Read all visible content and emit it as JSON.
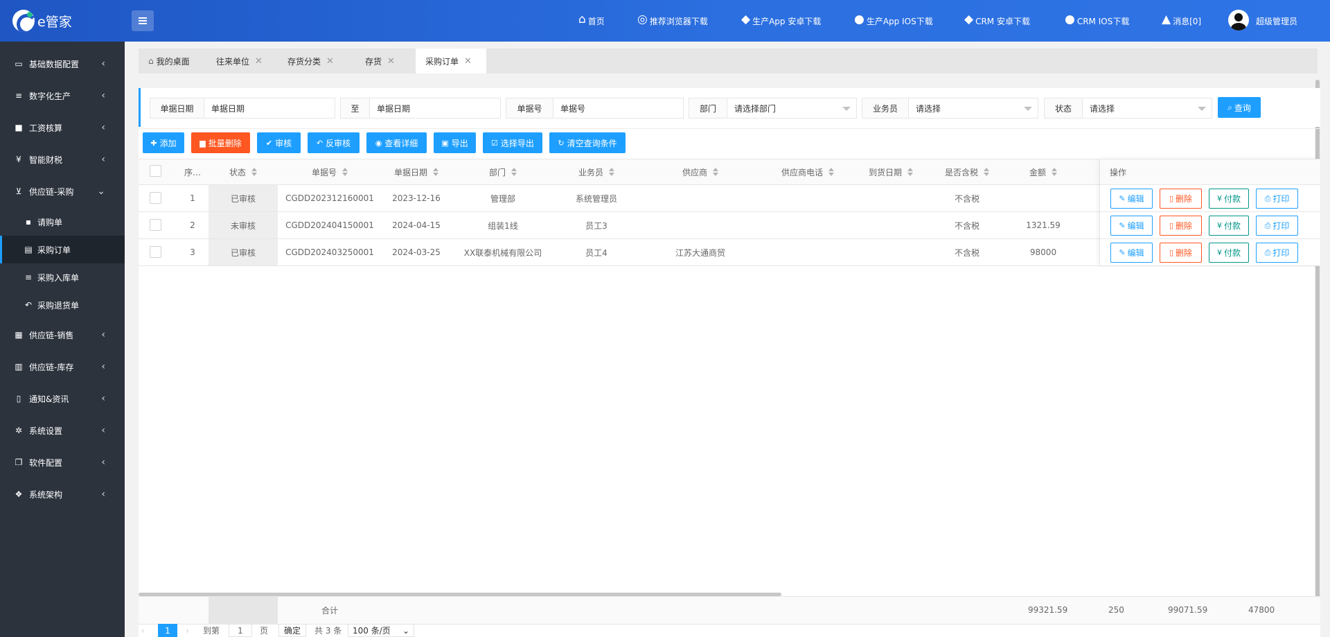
{
  "header": {
    "logo_text": "e管家",
    "nav": [
      {
        "icon": "home-icon",
        "glyph": "⌂",
        "label": "首页"
      },
      {
        "icon": "chrome-icon",
        "glyph": "◎",
        "label": "推荐浏览器下载"
      },
      {
        "icon": "android-icon",
        "glyph": "◆",
        "label": "生产App 安卓下载"
      },
      {
        "icon": "apple-icon",
        "glyph": "●",
        "label": "生产App IOS下载"
      },
      {
        "icon": "android-icon",
        "glyph": "◆",
        "label": "CRM 安卓下载"
      },
      {
        "icon": "apple-icon",
        "glyph": "●",
        "label": "CRM IOS下载"
      },
      {
        "icon": "bell-icon",
        "glyph": "▲",
        "label": "消息[0]"
      }
    ],
    "user_name": "超级管理员"
  },
  "sidebar": {
    "items": [
      {
        "icon": "id-card-icon",
        "glyph": "▭",
        "label": "基础数据配置"
      },
      {
        "icon": "sliders-icon",
        "glyph": "≡",
        "label": "数字化生产"
      },
      {
        "icon": "lock-icon",
        "glyph": "■",
        "label": "工资核算"
      },
      {
        "icon": "yen-icon",
        "glyph": "¥",
        "label": "智能财税"
      },
      {
        "icon": "cart-icon",
        "glyph": "⊻",
        "label": "供应链-采购"
      }
    ],
    "sub_items": [
      {
        "icon": "file-icon",
        "glyph": "▪",
        "label": "请购单"
      },
      {
        "icon": "document-icon",
        "glyph": "▤",
        "label": "采购订单"
      },
      {
        "icon": "list-icon",
        "glyph": "≡",
        "label": "采购入库单"
      },
      {
        "icon": "reply-icon",
        "glyph": "↶",
        "label": "采购退货单"
      }
    ],
    "items_after": [
      {
        "icon": "keyboard-icon",
        "glyph": "▦",
        "label": "供应链-销售"
      },
      {
        "icon": "bank-icon",
        "glyph": "▥",
        "label": "供应链-库存"
      },
      {
        "icon": "bookmark-icon",
        "glyph": "▯",
        "label": "通知&资讯"
      },
      {
        "icon": "gears-icon",
        "glyph": "✲",
        "label": "系统设置"
      },
      {
        "icon": "copy-icon",
        "glyph": "❐",
        "label": "软件配置"
      },
      {
        "icon": "cubes-icon",
        "glyph": "❖",
        "label": "系统架构"
      }
    ]
  },
  "tabs": [
    {
      "label": "我的桌面",
      "closable": false
    },
    {
      "label": "往来单位",
      "closable": true
    },
    {
      "label": "存货分类",
      "closable": true
    },
    {
      "label": "存货",
      "closable": true
    },
    {
      "label": "采购订单",
      "closable": true
    }
  ],
  "filters": {
    "date_label": "单据日期",
    "date_from_placeholder": "单据日期",
    "to_label": "至",
    "date_to_placeholder": "单据日期",
    "number_label": "单据号",
    "number_placeholder": "单据号",
    "dept_label": "部门",
    "dept_value": "请选择部门",
    "salesman_label": "业务员",
    "salesman_value": "请选择",
    "status_label": "状态",
    "status_value": "请选择",
    "query_label": "查询"
  },
  "toolbar": {
    "add": "添加",
    "batch_delete": "批量删除",
    "audit": "审核",
    "unaudit": "反审核",
    "view_detail": "查看详细",
    "export": "导出",
    "select_export": "选择导出",
    "clear_conditions": "清空查询条件"
  },
  "table": {
    "columns": [
      "序…",
      "状态",
      "单据号",
      "单据日期",
      "部门",
      "业务员",
      "供应商",
      "供应商电话",
      "到货日期",
      "是否含税",
      "金额",
      "操作"
    ],
    "rows": [
      {
        "seq": "1",
        "status": "已审核",
        "number": "CGDD202312160001",
        "date": "2023-12-16",
        "dept": "管理部",
        "salesman": "系统管理员",
        "supplier": "",
        "phone": "",
        "arrive": "",
        "tax": "不含税",
        "amount": ""
      },
      {
        "seq": "2",
        "status": "未审核",
        "number": "CGDD202404150001",
        "date": "2024-04-15",
        "dept": "组装1线",
        "salesman": "员工3",
        "supplier": "",
        "phone": "",
        "arrive": "",
        "tax": "不含税",
        "amount": "1321.59"
      },
      {
        "seq": "3",
        "status": "已审核",
        "number": "CGDD202403250001",
        "date": "2024-03-25",
        "dept": "XX联泰机械有限公司",
        "salesman": "员工4",
        "supplier": "江苏大通商贸",
        "phone": "",
        "arrive": "",
        "tax": "不含税",
        "amount": "98000"
      }
    ],
    "actions": {
      "edit": "编辑",
      "delete": "删除",
      "pay": "付款",
      "print": "打印"
    }
  },
  "totals": {
    "label": "合计",
    "values": [
      "99321.59",
      "250",
      "99071.59",
      "47800"
    ]
  },
  "pager": {
    "current": "1",
    "goto_label": "到第",
    "page_input": "1",
    "page_unit": "页",
    "confirm": "确定",
    "total": "共 3 条",
    "per_page": "100 条/页"
  }
}
